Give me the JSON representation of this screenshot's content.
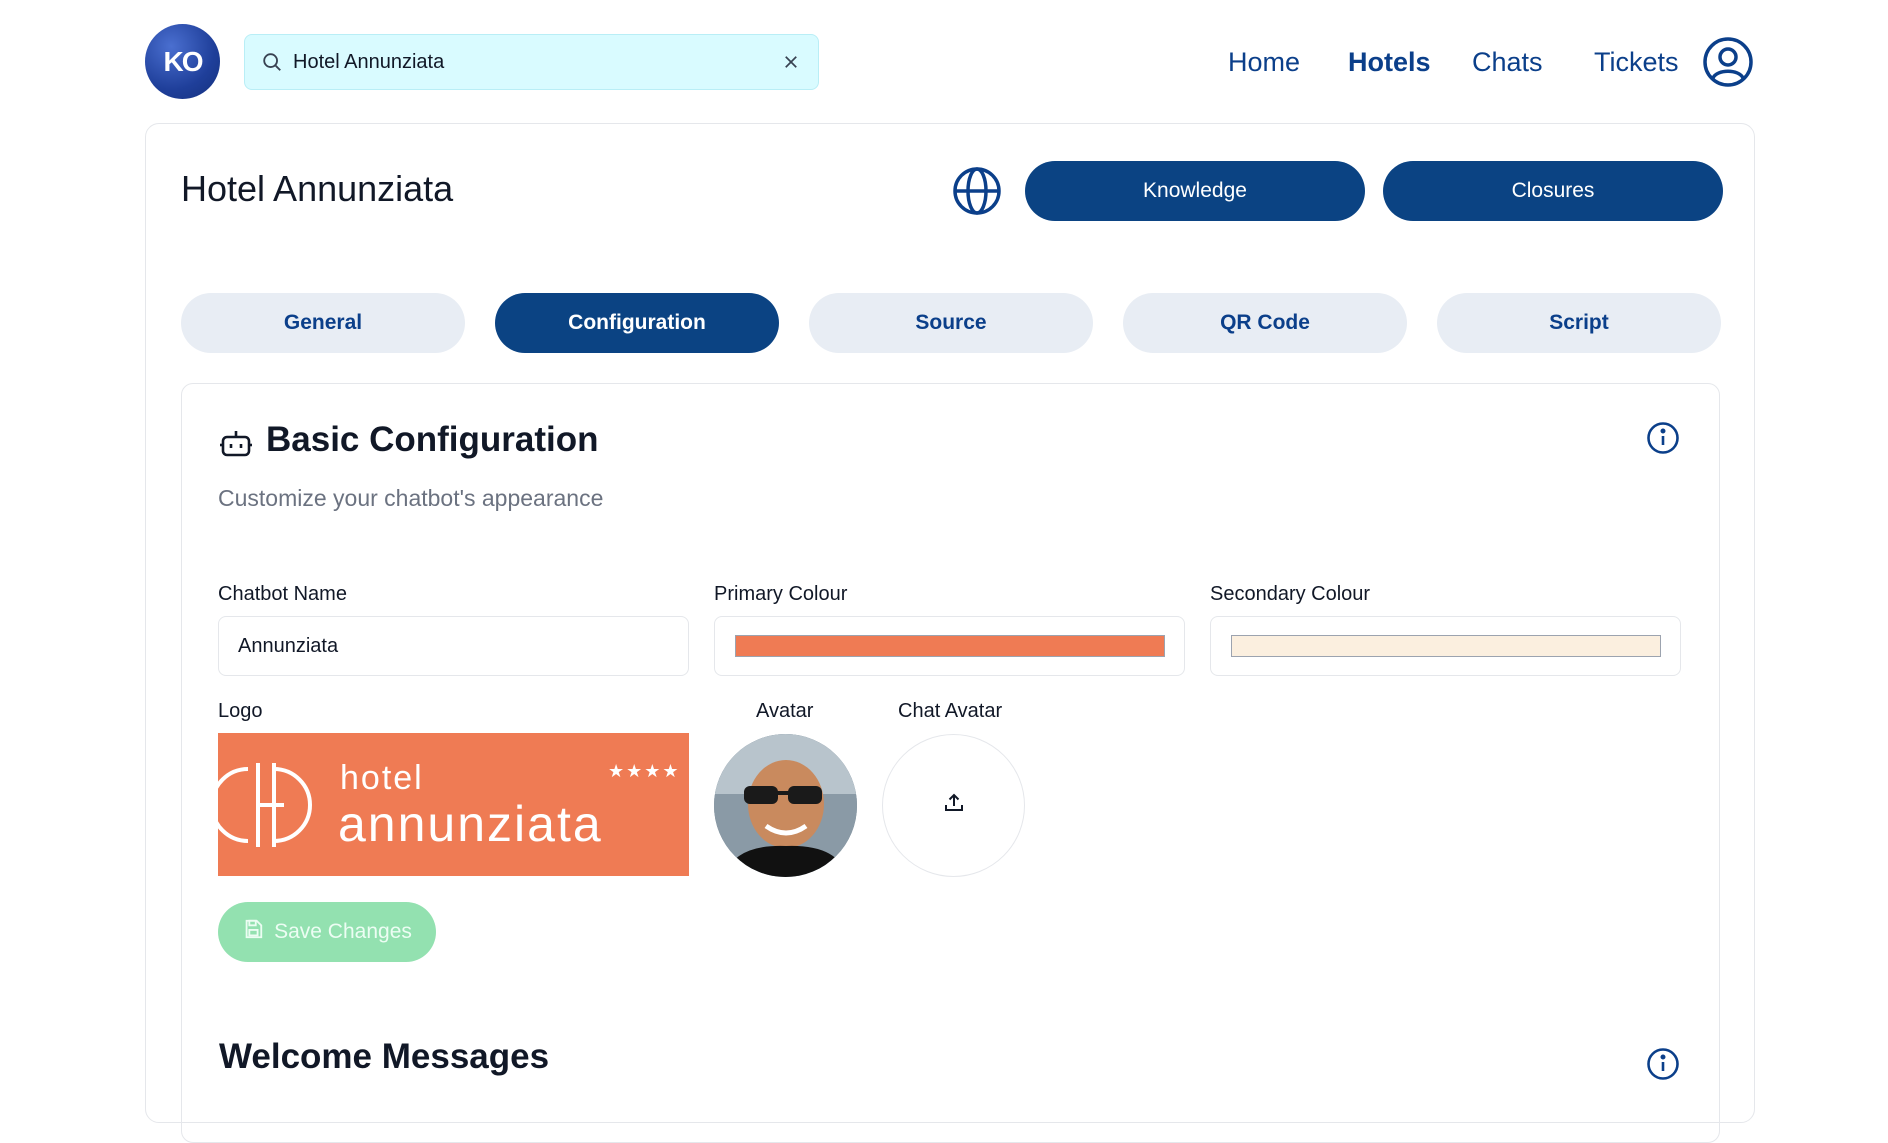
{
  "header": {
    "logo_text": "KO",
    "search": {
      "value": "Hotel Annunziata",
      "icon": "search-icon",
      "clear_icon": "close-icon"
    },
    "nav": [
      {
        "label": "Home",
        "active": false
      },
      {
        "label": "Hotels",
        "active": true
      },
      {
        "label": "Chats",
        "active": false
      },
      {
        "label": "Tickets",
        "active": false
      }
    ],
    "user_icon": "user-circle-icon"
  },
  "hotel": {
    "title": "Hotel Annunziata",
    "globe_icon": "globe-icon",
    "knowledge_label": "Knowledge",
    "closures_label": "Closures"
  },
  "tabs": [
    {
      "label": "General",
      "active": false
    },
    {
      "label": "Configuration",
      "active": true
    },
    {
      "label": "Source",
      "active": false
    },
    {
      "label": "QR Code",
      "active": false
    },
    {
      "label": "Script",
      "active": false
    }
  ],
  "basic_config": {
    "icon": "robot-icon",
    "title": "Basic Configuration",
    "subtitle": "Customize your chatbot's appearance",
    "info_icon": "info-icon",
    "chatbot_name_label": "Chatbot Name",
    "chatbot_name_value": "Annunziata",
    "primary_colour_label": "Primary Colour",
    "primary_colour": "#ef7b54",
    "secondary_colour_label": "Secondary Colour",
    "secondary_colour": "#fbefdf",
    "logo_label": "Logo",
    "logo_text_small": "hotel",
    "logo_text_large": "annunziata",
    "logo_stars": "★★★★",
    "avatar_label": "Avatar",
    "chat_avatar_label": "Chat Avatar",
    "upload_icon": "upload-icon",
    "save_label": "Save Changes",
    "save_icon": "save-icon"
  },
  "welcome": {
    "title": "Welcome Messages",
    "info_icon": "info-icon"
  },
  "colors": {
    "brand_blue": "#0b4383",
    "nav_text": "#0b3f8a",
    "tab_inactive_bg": "#e8edf4",
    "search_bg": "#d9fbff",
    "save_bg": "#93e1b0"
  }
}
